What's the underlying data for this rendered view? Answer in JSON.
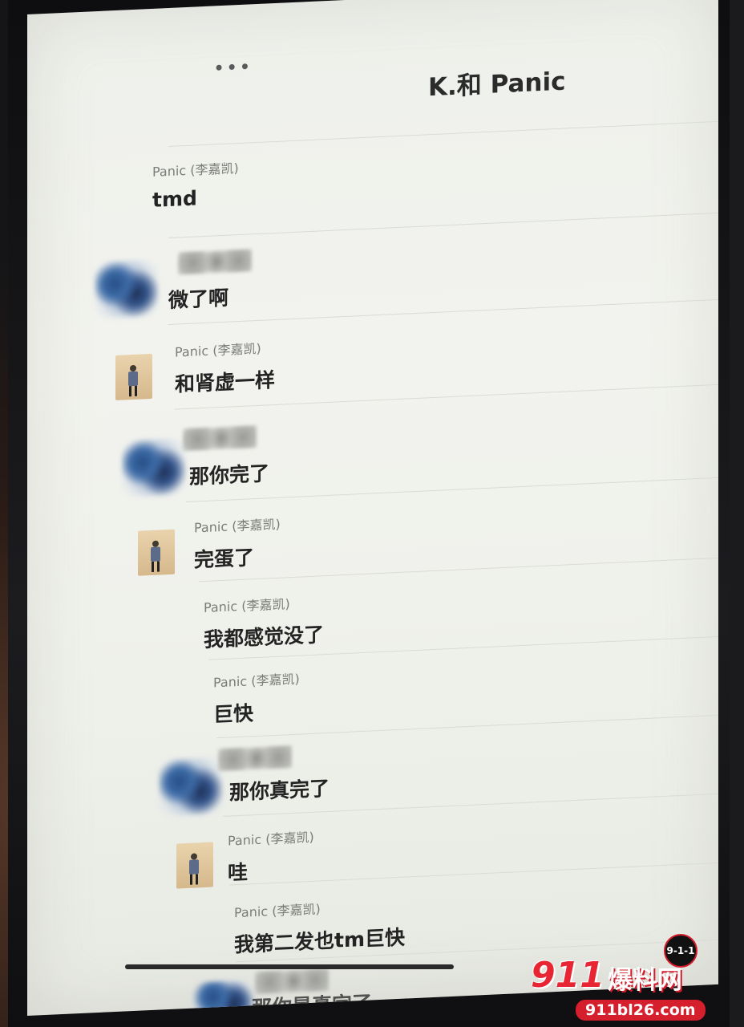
{
  "window": {
    "title": "K.和 Panic",
    "menu_icon": "ellipsis-icon"
  },
  "messages": [
    {
      "sender": "Panic (李嘉凯)",
      "text": "tmd"
    },
    {
      "sender": "",
      "text": "微了啊"
    },
    {
      "sender": "Panic (李嘉凯)",
      "text": "和肾虚一样"
    },
    {
      "sender": "",
      "text": "那你完了"
    },
    {
      "sender": "Panic (李嘉凯)",
      "text": "完蛋了"
    },
    {
      "sender": "Panic (李嘉凯)",
      "text": "我都感觉没了"
    },
    {
      "sender": "Panic (李嘉凯)",
      "text": "巨快"
    },
    {
      "sender": "",
      "text": "那你真完了"
    },
    {
      "sender": "Panic (李嘉凯)",
      "text": "哇"
    },
    {
      "sender": "Panic (李嘉凯)",
      "text": "我第二发也tm巨快"
    },
    {
      "sender": "",
      "text": "那你是真完了"
    }
  ],
  "watermark": {
    "badge": "9-1-1",
    "number": "911",
    "label": "爆料网",
    "url": "911bl26.com",
    "accent": "#e82633"
  }
}
